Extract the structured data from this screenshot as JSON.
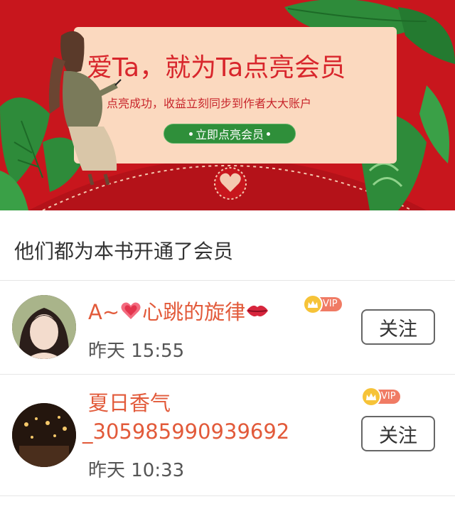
{
  "banner": {
    "title": "爱Ta，就为Ta点亮会员",
    "subtitle": "点亮成功，收益立刻同步到作者大大账户",
    "cta_label": "立即点亮会员"
  },
  "section": {
    "title": "他们都为本书开通了会员"
  },
  "members": [
    {
      "name_prefix": "A~",
      "name_main": "心跳的旋律",
      "time": "昨天 15:55",
      "vip_label": "VIP",
      "follow_label": "关注"
    },
    {
      "name_line1": "夏日香气",
      "name_line2": "_305985990939692",
      "time": "昨天 10:33",
      "vip_label": "VIP",
      "follow_label": "关注"
    }
  ],
  "colors": {
    "banner_red": "#c8161d",
    "card_peach": "#fbd9bf",
    "cta_green": "#2f8f3a",
    "name_orange": "#e25a3a",
    "vip_tag": "#f07b64",
    "vip_crown": "#f6c338"
  },
  "icons": {
    "heart_emblem": "heart-seal-icon",
    "sparkling_heart": "sparkling-heart-icon",
    "lips": "kiss-mark-icon",
    "crown": "crown-icon"
  }
}
